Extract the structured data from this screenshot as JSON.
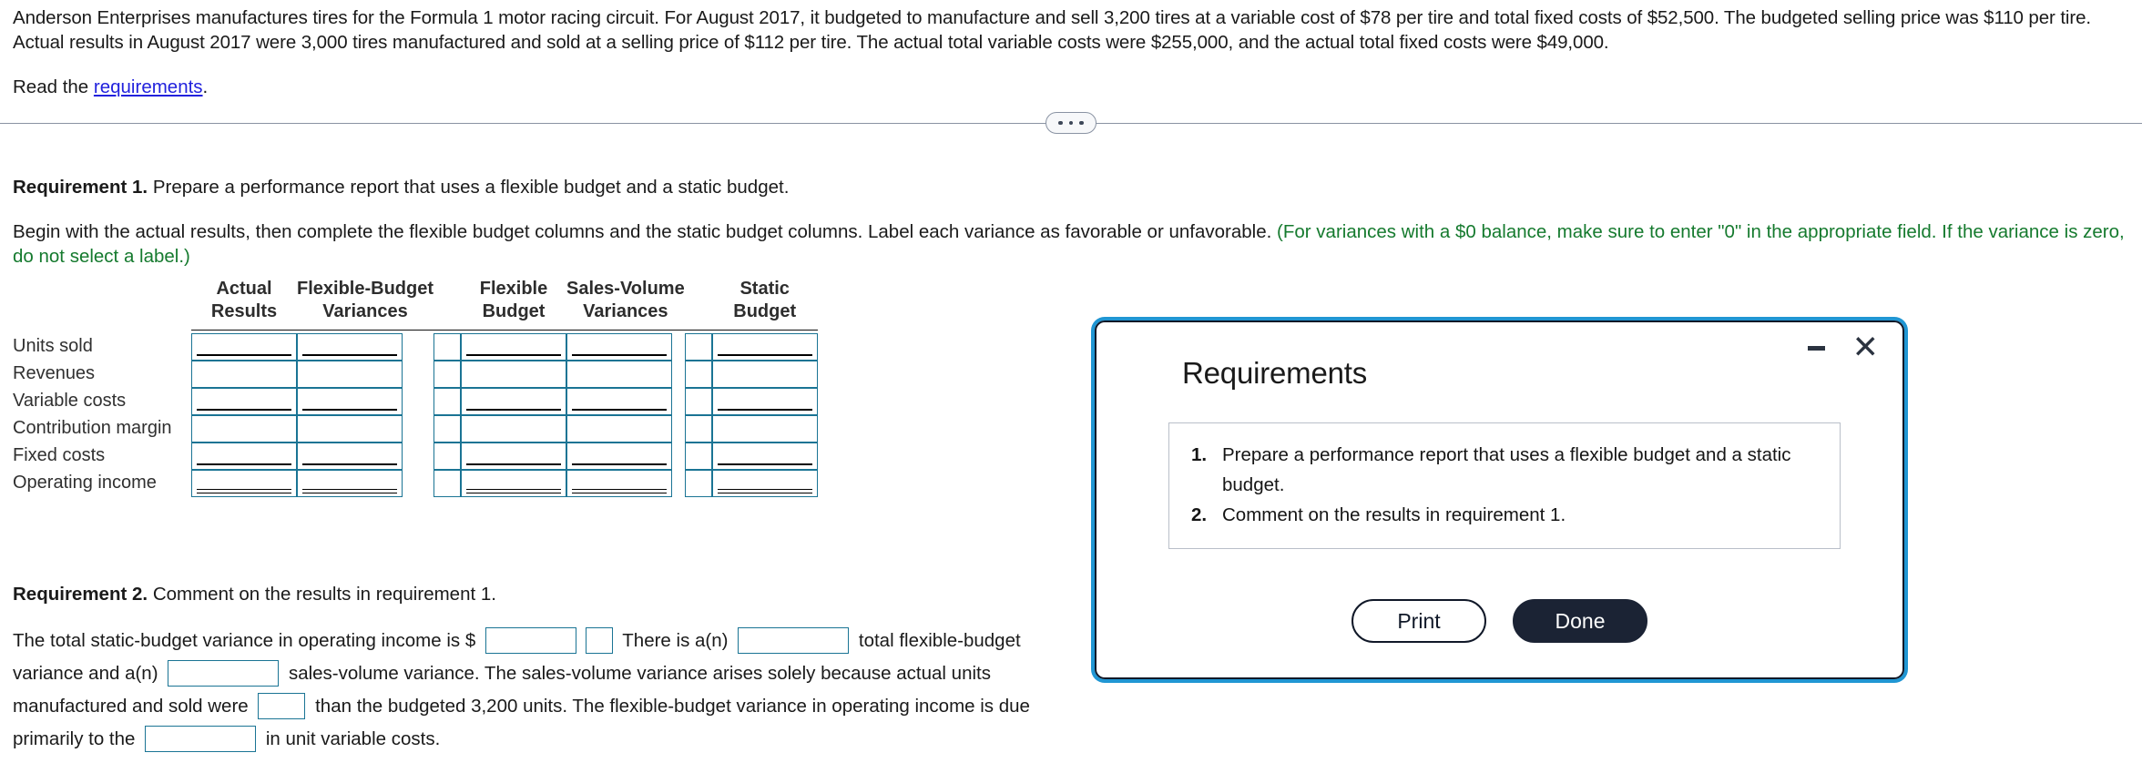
{
  "problem": {
    "statement": "Anderson Enterprises manufactures tires for the Formula 1 motor racing circuit. For August 2017, it budgeted to manufacture and sell 3,200 tires at a variable cost of $78 per tire and total fixed costs of $52,500. The budgeted selling price was $110 per tire. Actual results in August 2017 were 3,000 tires manufactured and sold at a selling price of $112 per tire. The actual total variable costs were $255,000, and the actual total fixed costs were $49,000.",
    "read_prefix": "Read the",
    "read_link": "requirements",
    "read_suffix": "."
  },
  "divider": {
    "icon": "ellipsis-icon"
  },
  "requirement1": {
    "label": "Requirement 1.",
    "text": "Prepare a performance report that uses a flexible budget and a static budget.",
    "instruction_plain": "Begin with the actual results, then complete the flexible budget columns and the static budget columns. Label each variance as favorable or unfavorable.",
    "instruction_note": "(For variances with a $0 balance, make sure to enter \"0\" in the appropriate field. If the variance is zero, do not select a label.)"
  },
  "table": {
    "headers_line1": [
      "Actual",
      "Flexible-Budget",
      "Flexible",
      "Sales-Volume",
      "Static"
    ],
    "headers_line2": [
      "Results",
      "Variances",
      "Budget",
      "Variances",
      "Budget"
    ],
    "rows": [
      {
        "label": "Units sold",
        "rule": "single"
      },
      {
        "label": "Revenues",
        "rule": "none"
      },
      {
        "label": "Variable costs",
        "rule": "single"
      },
      {
        "label": "Contribution margin",
        "rule": "none"
      },
      {
        "label": "Fixed costs",
        "rule": "single"
      },
      {
        "label": "Operating income",
        "rule": "double"
      }
    ],
    "cell_values": {
      "actual_results": [
        "",
        "",
        "",
        "",
        "",
        ""
      ],
      "flexible_budget_variances": [
        "",
        "",
        "",
        "",
        "",
        ""
      ],
      "flexible_budget_variance_labels": [
        "",
        "",
        "",
        "",
        "",
        ""
      ],
      "flexible_budget": [
        "",
        "",
        "",
        "",
        "",
        ""
      ],
      "sales_volume_variances": [
        "",
        "",
        "",
        "",
        "",
        ""
      ],
      "sales_volume_variance_labels": [
        "",
        "",
        "",
        "",
        "",
        ""
      ],
      "static_budget": [
        "",
        "",
        "",
        "",
        "",
        ""
      ]
    }
  },
  "requirement2": {
    "label": "Requirement 2.",
    "text": "Comment on the results in requirement 1.",
    "seg1": "The total static-budget variance in operating income is $",
    "seg2": "There is a(n)",
    "seg3": "total flexible-budget",
    "seg4": "variance and a(n)",
    "seg5": "sales-volume variance. The sales-volume variance arises solely because actual units",
    "seg6": "manufactured and sold were",
    "seg7": "than the budgeted 3,200 units. The flexible-budget variance in operating income is due",
    "seg8": "primarily to the",
    "seg9": "in unit variable costs.",
    "inputs": {
      "static_budget_variance_amount": "",
      "static_budget_variance_label": "",
      "flexible_budget_variance_type": "",
      "sales_volume_variance_type": "",
      "units_comparison": "",
      "variable_cost_change": ""
    }
  },
  "dialog": {
    "title": "Requirements",
    "minimize_icon": "minimize-icon",
    "close_icon": "close-icon",
    "items": [
      "Prepare a performance report that uses a flexible budget and a static budget.",
      "Comment on the results in requirement 1."
    ],
    "print_label": "Print",
    "done_label": "Done"
  },
  "colors": {
    "link": "#2222dd",
    "note_green": "#157a2e",
    "field_border": "#1a7494",
    "dialog_outer": "#2096d3",
    "dialog_inner": "#101828",
    "done_bg": "#1b2334"
  }
}
